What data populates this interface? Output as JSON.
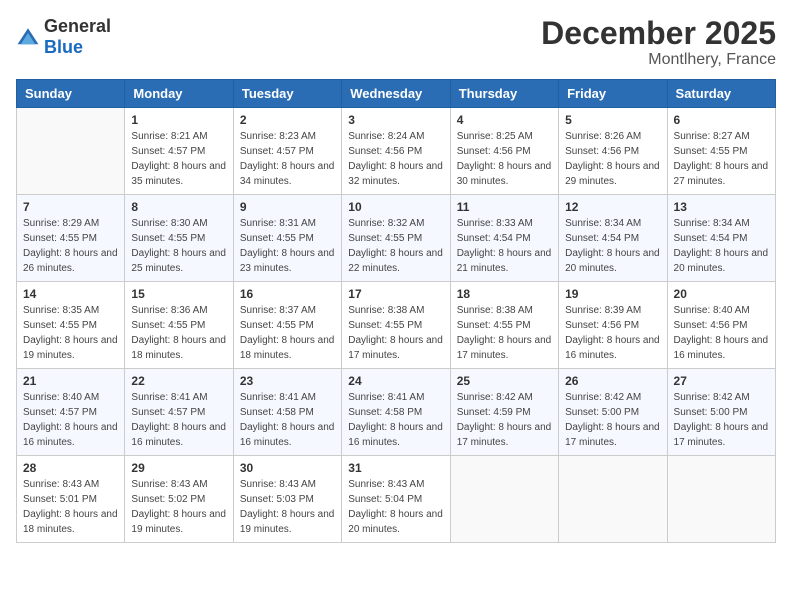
{
  "logo": {
    "general": "General",
    "blue": "Blue"
  },
  "header": {
    "month_year": "December 2025",
    "location": "Montlhery, France"
  },
  "weekdays": [
    "Sunday",
    "Monday",
    "Tuesday",
    "Wednesday",
    "Thursday",
    "Friday",
    "Saturday"
  ],
  "weeks": [
    [
      {
        "day": "",
        "sunrise": "",
        "sunset": "",
        "daylight": ""
      },
      {
        "day": "1",
        "sunrise": "8:21 AM",
        "sunset": "4:57 PM",
        "daylight": "8 hours and 35 minutes."
      },
      {
        "day": "2",
        "sunrise": "8:23 AM",
        "sunset": "4:57 PM",
        "daylight": "8 hours and 34 minutes."
      },
      {
        "day": "3",
        "sunrise": "8:24 AM",
        "sunset": "4:56 PM",
        "daylight": "8 hours and 32 minutes."
      },
      {
        "day": "4",
        "sunrise": "8:25 AM",
        "sunset": "4:56 PM",
        "daylight": "8 hours and 30 minutes."
      },
      {
        "day": "5",
        "sunrise": "8:26 AM",
        "sunset": "4:56 PM",
        "daylight": "8 hours and 29 minutes."
      },
      {
        "day": "6",
        "sunrise": "8:27 AM",
        "sunset": "4:55 PM",
        "daylight": "8 hours and 27 minutes."
      }
    ],
    [
      {
        "day": "7",
        "sunrise": "8:29 AM",
        "sunset": "4:55 PM",
        "daylight": "8 hours and 26 minutes."
      },
      {
        "day": "8",
        "sunrise": "8:30 AM",
        "sunset": "4:55 PM",
        "daylight": "8 hours and 25 minutes."
      },
      {
        "day": "9",
        "sunrise": "8:31 AM",
        "sunset": "4:55 PM",
        "daylight": "8 hours and 23 minutes."
      },
      {
        "day": "10",
        "sunrise": "8:32 AM",
        "sunset": "4:55 PM",
        "daylight": "8 hours and 22 minutes."
      },
      {
        "day": "11",
        "sunrise": "8:33 AM",
        "sunset": "4:54 PM",
        "daylight": "8 hours and 21 minutes."
      },
      {
        "day": "12",
        "sunrise": "8:34 AM",
        "sunset": "4:54 PM",
        "daylight": "8 hours and 20 minutes."
      },
      {
        "day": "13",
        "sunrise": "8:34 AM",
        "sunset": "4:54 PM",
        "daylight": "8 hours and 20 minutes."
      }
    ],
    [
      {
        "day": "14",
        "sunrise": "8:35 AM",
        "sunset": "4:55 PM",
        "daylight": "8 hours and 19 minutes."
      },
      {
        "day": "15",
        "sunrise": "8:36 AM",
        "sunset": "4:55 PM",
        "daylight": "8 hours and 18 minutes."
      },
      {
        "day": "16",
        "sunrise": "8:37 AM",
        "sunset": "4:55 PM",
        "daylight": "8 hours and 18 minutes."
      },
      {
        "day": "17",
        "sunrise": "8:38 AM",
        "sunset": "4:55 PM",
        "daylight": "8 hours and 17 minutes."
      },
      {
        "day": "18",
        "sunrise": "8:38 AM",
        "sunset": "4:55 PM",
        "daylight": "8 hours and 17 minutes."
      },
      {
        "day": "19",
        "sunrise": "8:39 AM",
        "sunset": "4:56 PM",
        "daylight": "8 hours and 16 minutes."
      },
      {
        "day": "20",
        "sunrise": "8:40 AM",
        "sunset": "4:56 PM",
        "daylight": "8 hours and 16 minutes."
      }
    ],
    [
      {
        "day": "21",
        "sunrise": "8:40 AM",
        "sunset": "4:57 PM",
        "daylight": "8 hours and 16 minutes."
      },
      {
        "day": "22",
        "sunrise": "8:41 AM",
        "sunset": "4:57 PM",
        "daylight": "8 hours and 16 minutes."
      },
      {
        "day": "23",
        "sunrise": "8:41 AM",
        "sunset": "4:58 PM",
        "daylight": "8 hours and 16 minutes."
      },
      {
        "day": "24",
        "sunrise": "8:41 AM",
        "sunset": "4:58 PM",
        "daylight": "8 hours and 16 minutes."
      },
      {
        "day": "25",
        "sunrise": "8:42 AM",
        "sunset": "4:59 PM",
        "daylight": "8 hours and 17 minutes."
      },
      {
        "day": "26",
        "sunrise": "8:42 AM",
        "sunset": "5:00 PM",
        "daylight": "8 hours and 17 minutes."
      },
      {
        "day": "27",
        "sunrise": "8:42 AM",
        "sunset": "5:00 PM",
        "daylight": "8 hours and 17 minutes."
      }
    ],
    [
      {
        "day": "28",
        "sunrise": "8:43 AM",
        "sunset": "5:01 PM",
        "daylight": "8 hours and 18 minutes."
      },
      {
        "day": "29",
        "sunrise": "8:43 AM",
        "sunset": "5:02 PM",
        "daylight": "8 hours and 19 minutes."
      },
      {
        "day": "30",
        "sunrise": "8:43 AM",
        "sunset": "5:03 PM",
        "daylight": "8 hours and 19 minutes."
      },
      {
        "day": "31",
        "sunrise": "8:43 AM",
        "sunset": "5:04 PM",
        "daylight": "8 hours and 20 minutes."
      },
      {
        "day": "",
        "sunrise": "",
        "sunset": "",
        "daylight": ""
      },
      {
        "day": "",
        "sunrise": "",
        "sunset": "",
        "daylight": ""
      },
      {
        "day": "",
        "sunrise": "",
        "sunset": "",
        "daylight": ""
      }
    ]
  ],
  "labels": {
    "sunrise": "Sunrise:",
    "sunset": "Sunset:",
    "daylight": "Daylight:"
  }
}
